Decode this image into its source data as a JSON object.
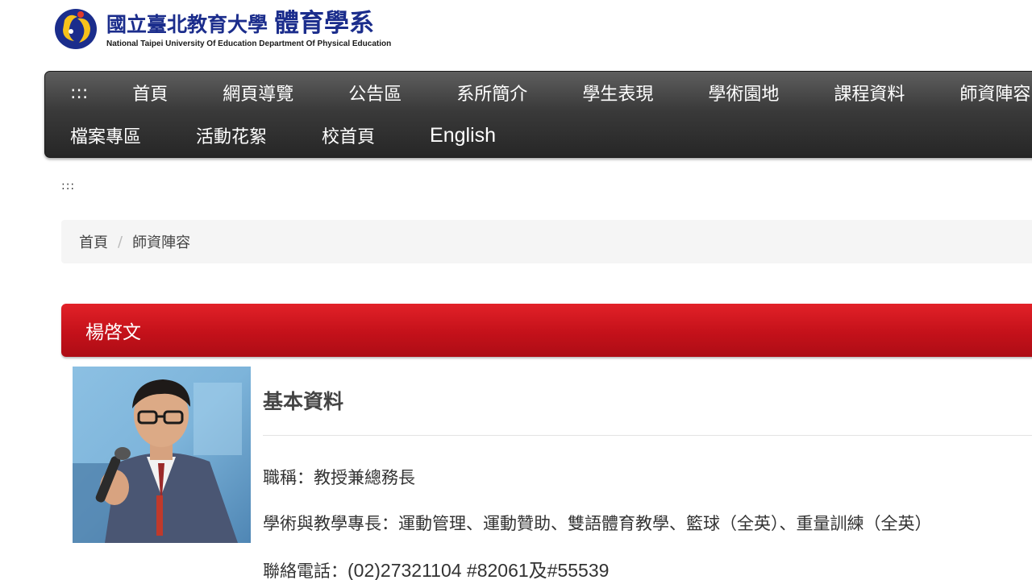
{
  "header": {
    "title_cn": "國立臺北教育大學",
    "dept_cn": "體育學系",
    "title_en": "National Taipei University Of Education Department Of Physical Education"
  },
  "nav": {
    "row1": [
      ":::",
      "首頁",
      "網頁導覽",
      "公告區",
      "系所簡介",
      "學生表現",
      "學術園地",
      "課程資料",
      "師資陣容"
    ],
    "row2": [
      "檔案專區",
      "活動花絮",
      "校首頁",
      "English"
    ]
  },
  "accesskey": ":::",
  "breadcrumb": {
    "home": "首頁",
    "separator": "/",
    "current": "師資陣容"
  },
  "profile": {
    "name": "楊啓文",
    "section_title": "基本資料",
    "title_line": "職稱：教授兼總務長",
    "expertise_line": "學術與教學專長：運動管理、運動贊助、雙語體育教學、籃球（全英）、重量訓練（全英）",
    "phone_label": "聯絡電話：",
    "phone_value": "(02)27321104 #82061及#55539"
  },
  "colors": {
    "brand_blue": "#1b2d8c",
    "title_red": "#c4111a",
    "nav_dark": "#333333"
  }
}
